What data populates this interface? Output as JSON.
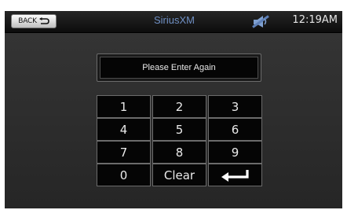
{
  "header": {
    "back_label": "BACK",
    "title": "SiriusXM",
    "time": "12:19AM",
    "mute_icon": "mute-speaker-icon",
    "title_color": "#6f8fc3"
  },
  "prompt": {
    "text": "Please Enter Again"
  },
  "keypad": {
    "keys": [
      "1",
      "2",
      "3",
      "4",
      "5",
      "6",
      "7",
      "8",
      "9",
      "0",
      "Clear"
    ],
    "enter_icon": "enter-return-icon"
  }
}
